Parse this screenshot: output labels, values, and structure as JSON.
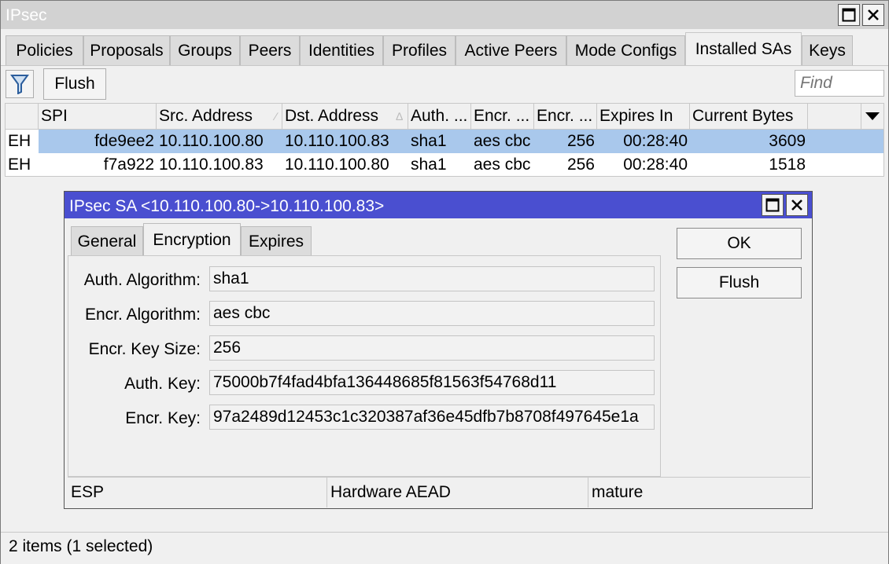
{
  "window": {
    "title": "IPsec"
  },
  "tabs": [
    "Policies",
    "Proposals",
    "Groups",
    "Peers",
    "Identities",
    "Profiles",
    "Active Peers",
    "Mode Configs",
    "Installed SAs",
    "Keys"
  ],
  "active_tab": "Installed SAs",
  "toolbar": {
    "flush_label": "Flush",
    "find_placeholder": "Find"
  },
  "table": {
    "columns": [
      "SPI",
      "Src. Address",
      "Dst. Address",
      "Auth. ...",
      "Encr. ...",
      "Encr. ...",
      "Expires In",
      "Current Bytes"
    ],
    "rows": [
      {
        "flag": "EH",
        "spi": "fde9ee2",
        "src": "10.110.100.80",
        "dst": "10.110.100.83",
        "auth": "sha1",
        "encr": "aes cbc",
        "keysize": "256",
        "expires": "00:28:40",
        "bytes": "3609",
        "selected": true
      },
      {
        "flag": "EH",
        "spi": "f7a922",
        "src": "10.110.100.83",
        "dst": "10.110.100.80",
        "auth": "sha1",
        "encr": "aes cbc",
        "keysize": "256",
        "expires": "00:28:40",
        "bytes": "1518",
        "selected": false
      }
    ]
  },
  "status": "2 items (1 selected)",
  "dialog": {
    "title": "IPsec SA <10.110.100.80->10.110.100.83>",
    "tabs": [
      "General",
      "Encryption",
      "Expires"
    ],
    "active_tab": "Encryption",
    "fields": [
      {
        "label": "Auth. Algorithm:",
        "value": "sha1"
      },
      {
        "label": "Encr. Algorithm:",
        "value": "aes cbc"
      },
      {
        "label": "Encr. Key Size:",
        "value": "256"
      },
      {
        "label": "Auth. Key:",
        "value": "75000b7f4fad4bfa136448685f81563f54768d11"
      },
      {
        "label": "Encr. Key:",
        "value": "97a2489d12453c1c320387af36e45dfb7b8708f497645e1a"
      }
    ],
    "ok_label": "OK",
    "flush_label": "Flush",
    "status": [
      "ESP",
      "Hardware AEAD",
      "mature"
    ]
  },
  "colors": {
    "dialog_title_bg": "#4a4fd0",
    "selected_row_bg": "#a9c8ec",
    "window_title_bg": "#d2d2d2"
  }
}
